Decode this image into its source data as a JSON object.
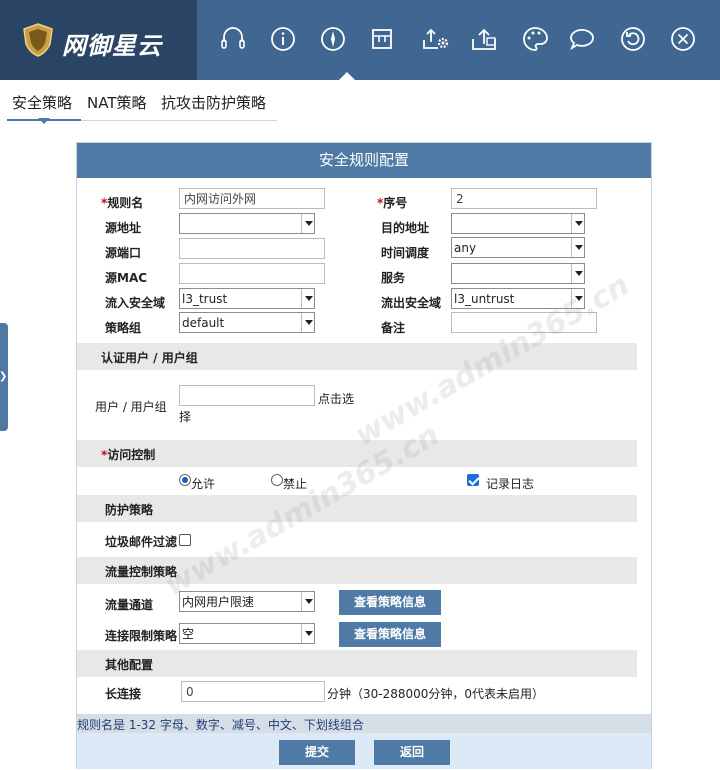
{
  "brand": {
    "name": "网御星云"
  },
  "toolbar": {
    "icons": [
      "headset-icon",
      "info-icon",
      "compass-icon",
      "dock-icon",
      "upload-gear-icon",
      "upload-icon",
      "palette-icon",
      "chat-icon",
      "refresh-icon",
      "close-icon"
    ]
  },
  "tabs": [
    {
      "label": "安全策略",
      "active": true
    },
    {
      "label": "NAT策略",
      "active": false
    },
    {
      "label": "抗攻击防护策略",
      "active": false
    }
  ],
  "panel": {
    "title": "安全规则配置",
    "required_mark": "*",
    "fields": {
      "rule_name": {
        "label": "规则名",
        "value": "内网访问外网"
      },
      "seq": {
        "label": "序号",
        "value": "2"
      },
      "src_addr": {
        "label": "源地址",
        "value": ""
      },
      "dst_addr": {
        "label": "目的地址",
        "value": ""
      },
      "src_port": {
        "label": "源端口",
        "value": ""
      },
      "schedule": {
        "label": "时间调度",
        "value": "any"
      },
      "src_mac": {
        "label": "源MAC",
        "value": ""
      },
      "service": {
        "label": "服务",
        "value": ""
      },
      "in_zone": {
        "label": "流入安全域",
        "value": "l3_trust"
      },
      "out_zone": {
        "label": "流出安全域",
        "value": "l3_untrust"
      },
      "policy_group": {
        "label": "策略组",
        "value": "default"
      },
      "remark": {
        "label": "备注",
        "value": ""
      }
    },
    "auth": {
      "section": "认证用户 / 用户组",
      "label": "用户 / 用户组",
      "value": "",
      "link_line1": "点击选",
      "link_line2": "择"
    },
    "access": {
      "section": "访问控制",
      "allow": "允许",
      "deny": "禁止",
      "log": "记录日志",
      "allow_checked": true,
      "log_checked": true
    },
    "protect": {
      "section": "防护策略",
      "spam_label": "垃圾邮件过滤",
      "spam_checked": false
    },
    "flow": {
      "section": "流量控制策略",
      "channel_label": "流量通道",
      "channel_value": "内网用户限速",
      "limit_label": "连接限制策略",
      "limit_value": "空",
      "view_button": "查看策略信息"
    },
    "other": {
      "section": "其他配置",
      "keepalive_label": "长连接",
      "keepalive_value": "0",
      "keepalive_hint": "分钟（30-288000分钟，0代表未启用）"
    },
    "note": "规则名是 1-32 字母、数字、减号、中文、下划线组合",
    "submit": "提交",
    "back": "返回"
  },
  "watermark": "www.admin365.cn",
  "colors": {
    "header": "#3f6792",
    "logo_bg": "#2a4466",
    "panel_title": "#4f7aa6",
    "required": "#d0021b"
  }
}
